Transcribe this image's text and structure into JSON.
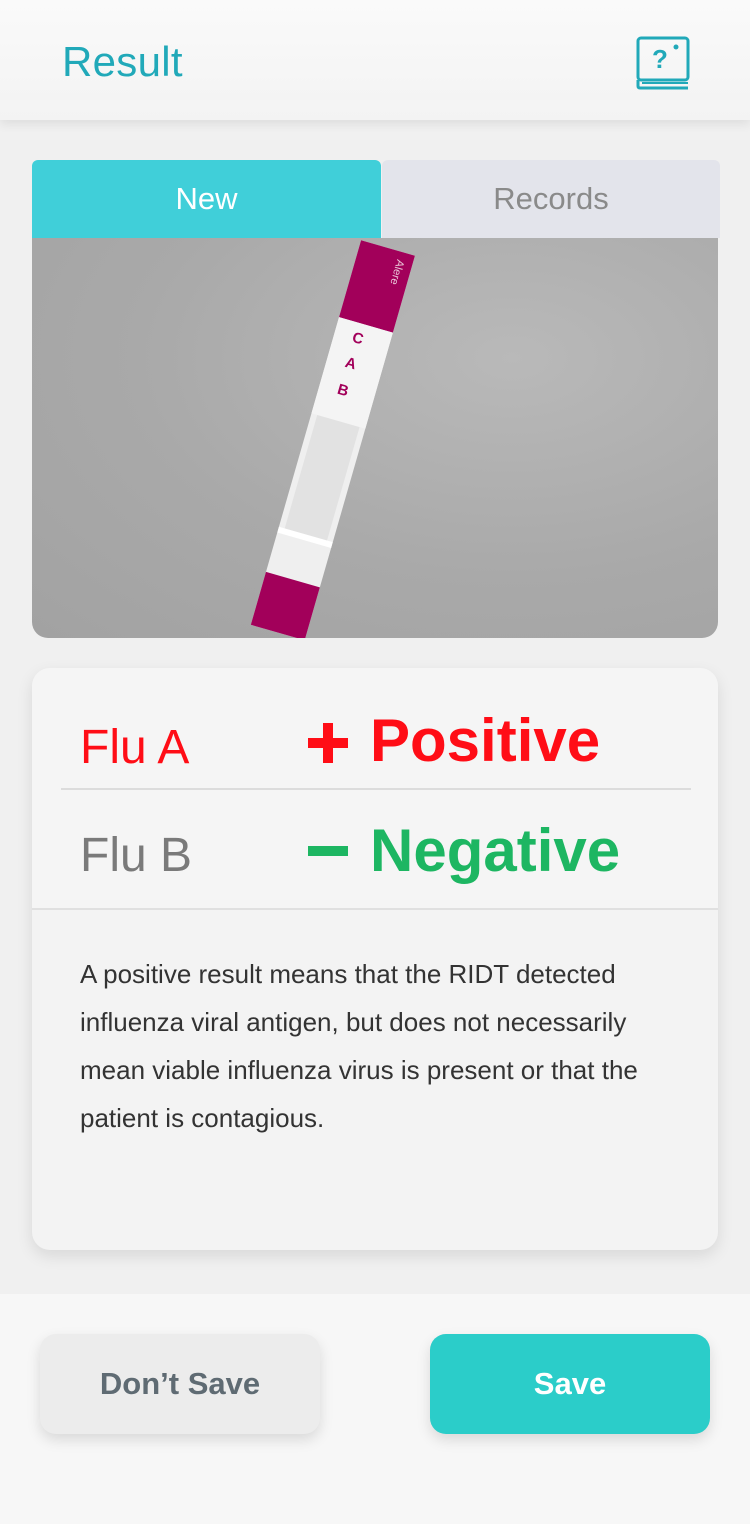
{
  "header": {
    "title": "Result",
    "help_icon": "help-book-icon"
  },
  "tabs": [
    {
      "label": "New",
      "active": true
    },
    {
      "label": "Records",
      "active": false
    }
  ],
  "test_strip": {
    "brand_text": "Alere",
    "markers": [
      "C",
      "A",
      "B"
    ],
    "strip_color": "#a2005a"
  },
  "results": [
    {
      "label": "Flu A",
      "sign": "+",
      "value": "Positive",
      "color": "#ff0d16"
    },
    {
      "label": "Flu B",
      "sign": "−",
      "value": "Negative",
      "color": "#1db662"
    }
  ],
  "description": "A positive result means that the RIDT detected influenza viral antigen, but does not necessarily mean viable influenza virus is present or that the patient is contagious.",
  "actions": {
    "dont_save": "Don’t Save",
    "save": "Save"
  },
  "colors": {
    "accent": "#40cfd9",
    "title": "#21a9b9",
    "save": "#2bcdc9"
  }
}
